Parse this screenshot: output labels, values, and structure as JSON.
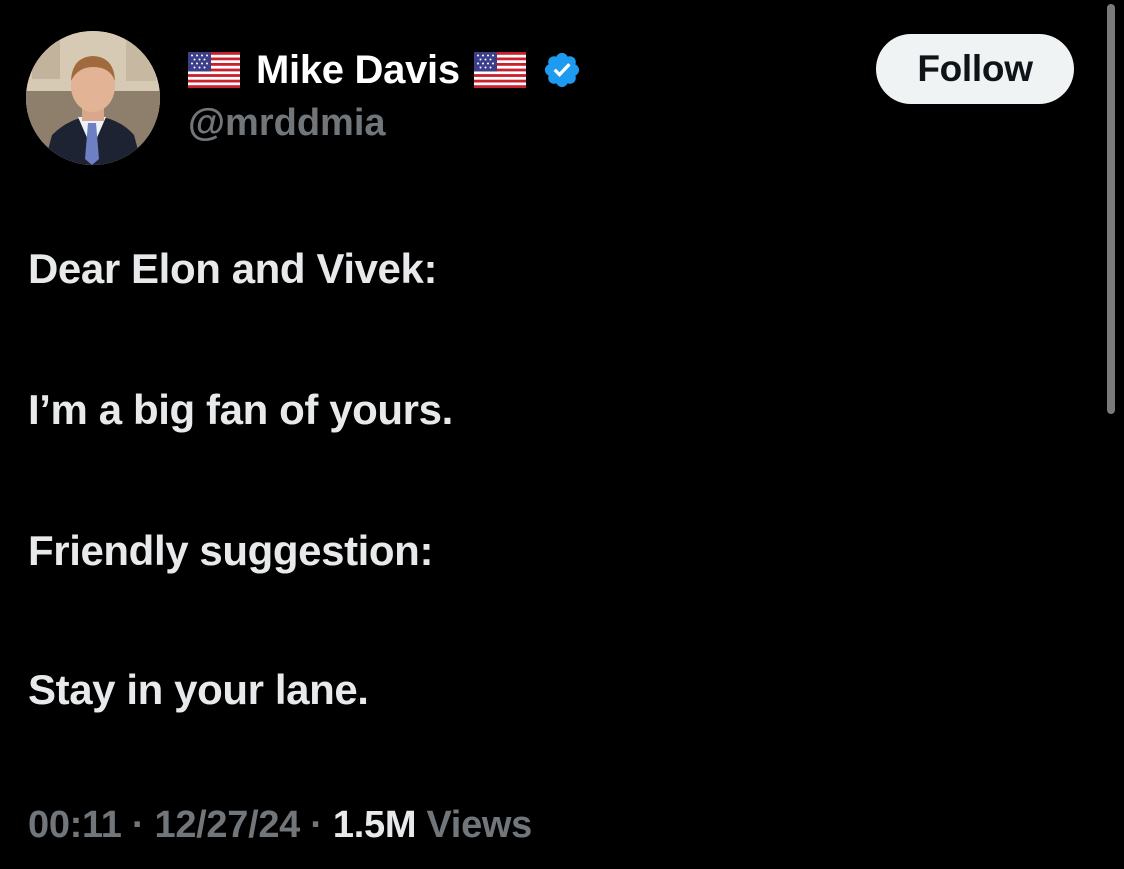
{
  "author": {
    "display_name": "Mike Davis",
    "handle": "@mrddmia",
    "verified": true,
    "flag_icon": "us-flag-icon",
    "verified_icon": "verified-badge-icon",
    "verified_color": "#1d9bf0"
  },
  "follow_button": {
    "label": "Follow"
  },
  "tweet": {
    "lines": [
      "Dear Elon and Vivek:",
      "I’m a big fan of yours.",
      "Friendly suggestion:",
      "Stay in your lane."
    ]
  },
  "meta": {
    "time": "00:11",
    "separator": "·",
    "date": "12/27/24",
    "views_count": "1.5M",
    "views_label": "Views"
  },
  "colors": {
    "background": "#000000",
    "text": "#e7e9ea",
    "secondary_text": "#71767b",
    "button_bg": "#eff3f4"
  }
}
